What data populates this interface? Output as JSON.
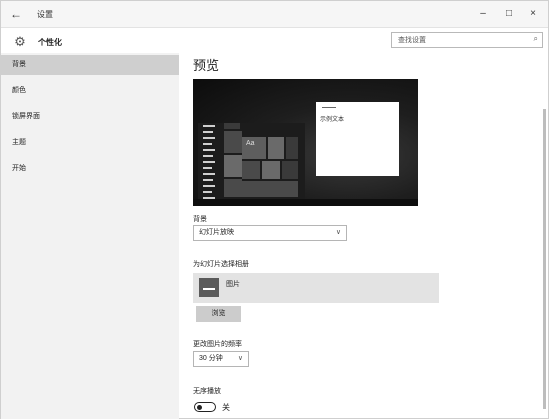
{
  "window": {
    "title": "设置",
    "back_icon": "←",
    "minimize_icon": "–",
    "maximize_icon": "□",
    "close_icon": "×"
  },
  "header": {
    "title": "个性化",
    "gear_icon": "⚙",
    "search_placeholder": "查找设置",
    "search_icon": "⌕"
  },
  "sidebar": {
    "items": [
      {
        "label": "背景",
        "active": true
      },
      {
        "label": "颜色",
        "active": false
      },
      {
        "label": "锁屏界面",
        "active": false
      },
      {
        "label": "主题",
        "active": false
      },
      {
        "label": "开始",
        "active": false
      }
    ]
  },
  "main": {
    "preview_title": "预览",
    "preview_tile_text": "Aa",
    "preview_sample_text": "示例文本",
    "background_label": "背景",
    "background_value": "幻灯片放映",
    "background_chevron": "∨",
    "album_label": "为幻灯片选择相册",
    "album_folder": "图片",
    "browse_label": "浏览",
    "interval_label": "更改图片的频率",
    "interval_value": "30 分钟",
    "interval_chevron": "∨",
    "shuffle_label": "无序播放",
    "shuffle_state": "关"
  },
  "colors": {
    "sidebar_bg": "#f2f2f2",
    "active_item_bg": "#cfcfcf",
    "album_bg": "#e3e3e3",
    "button_bg": "#cccccc"
  }
}
